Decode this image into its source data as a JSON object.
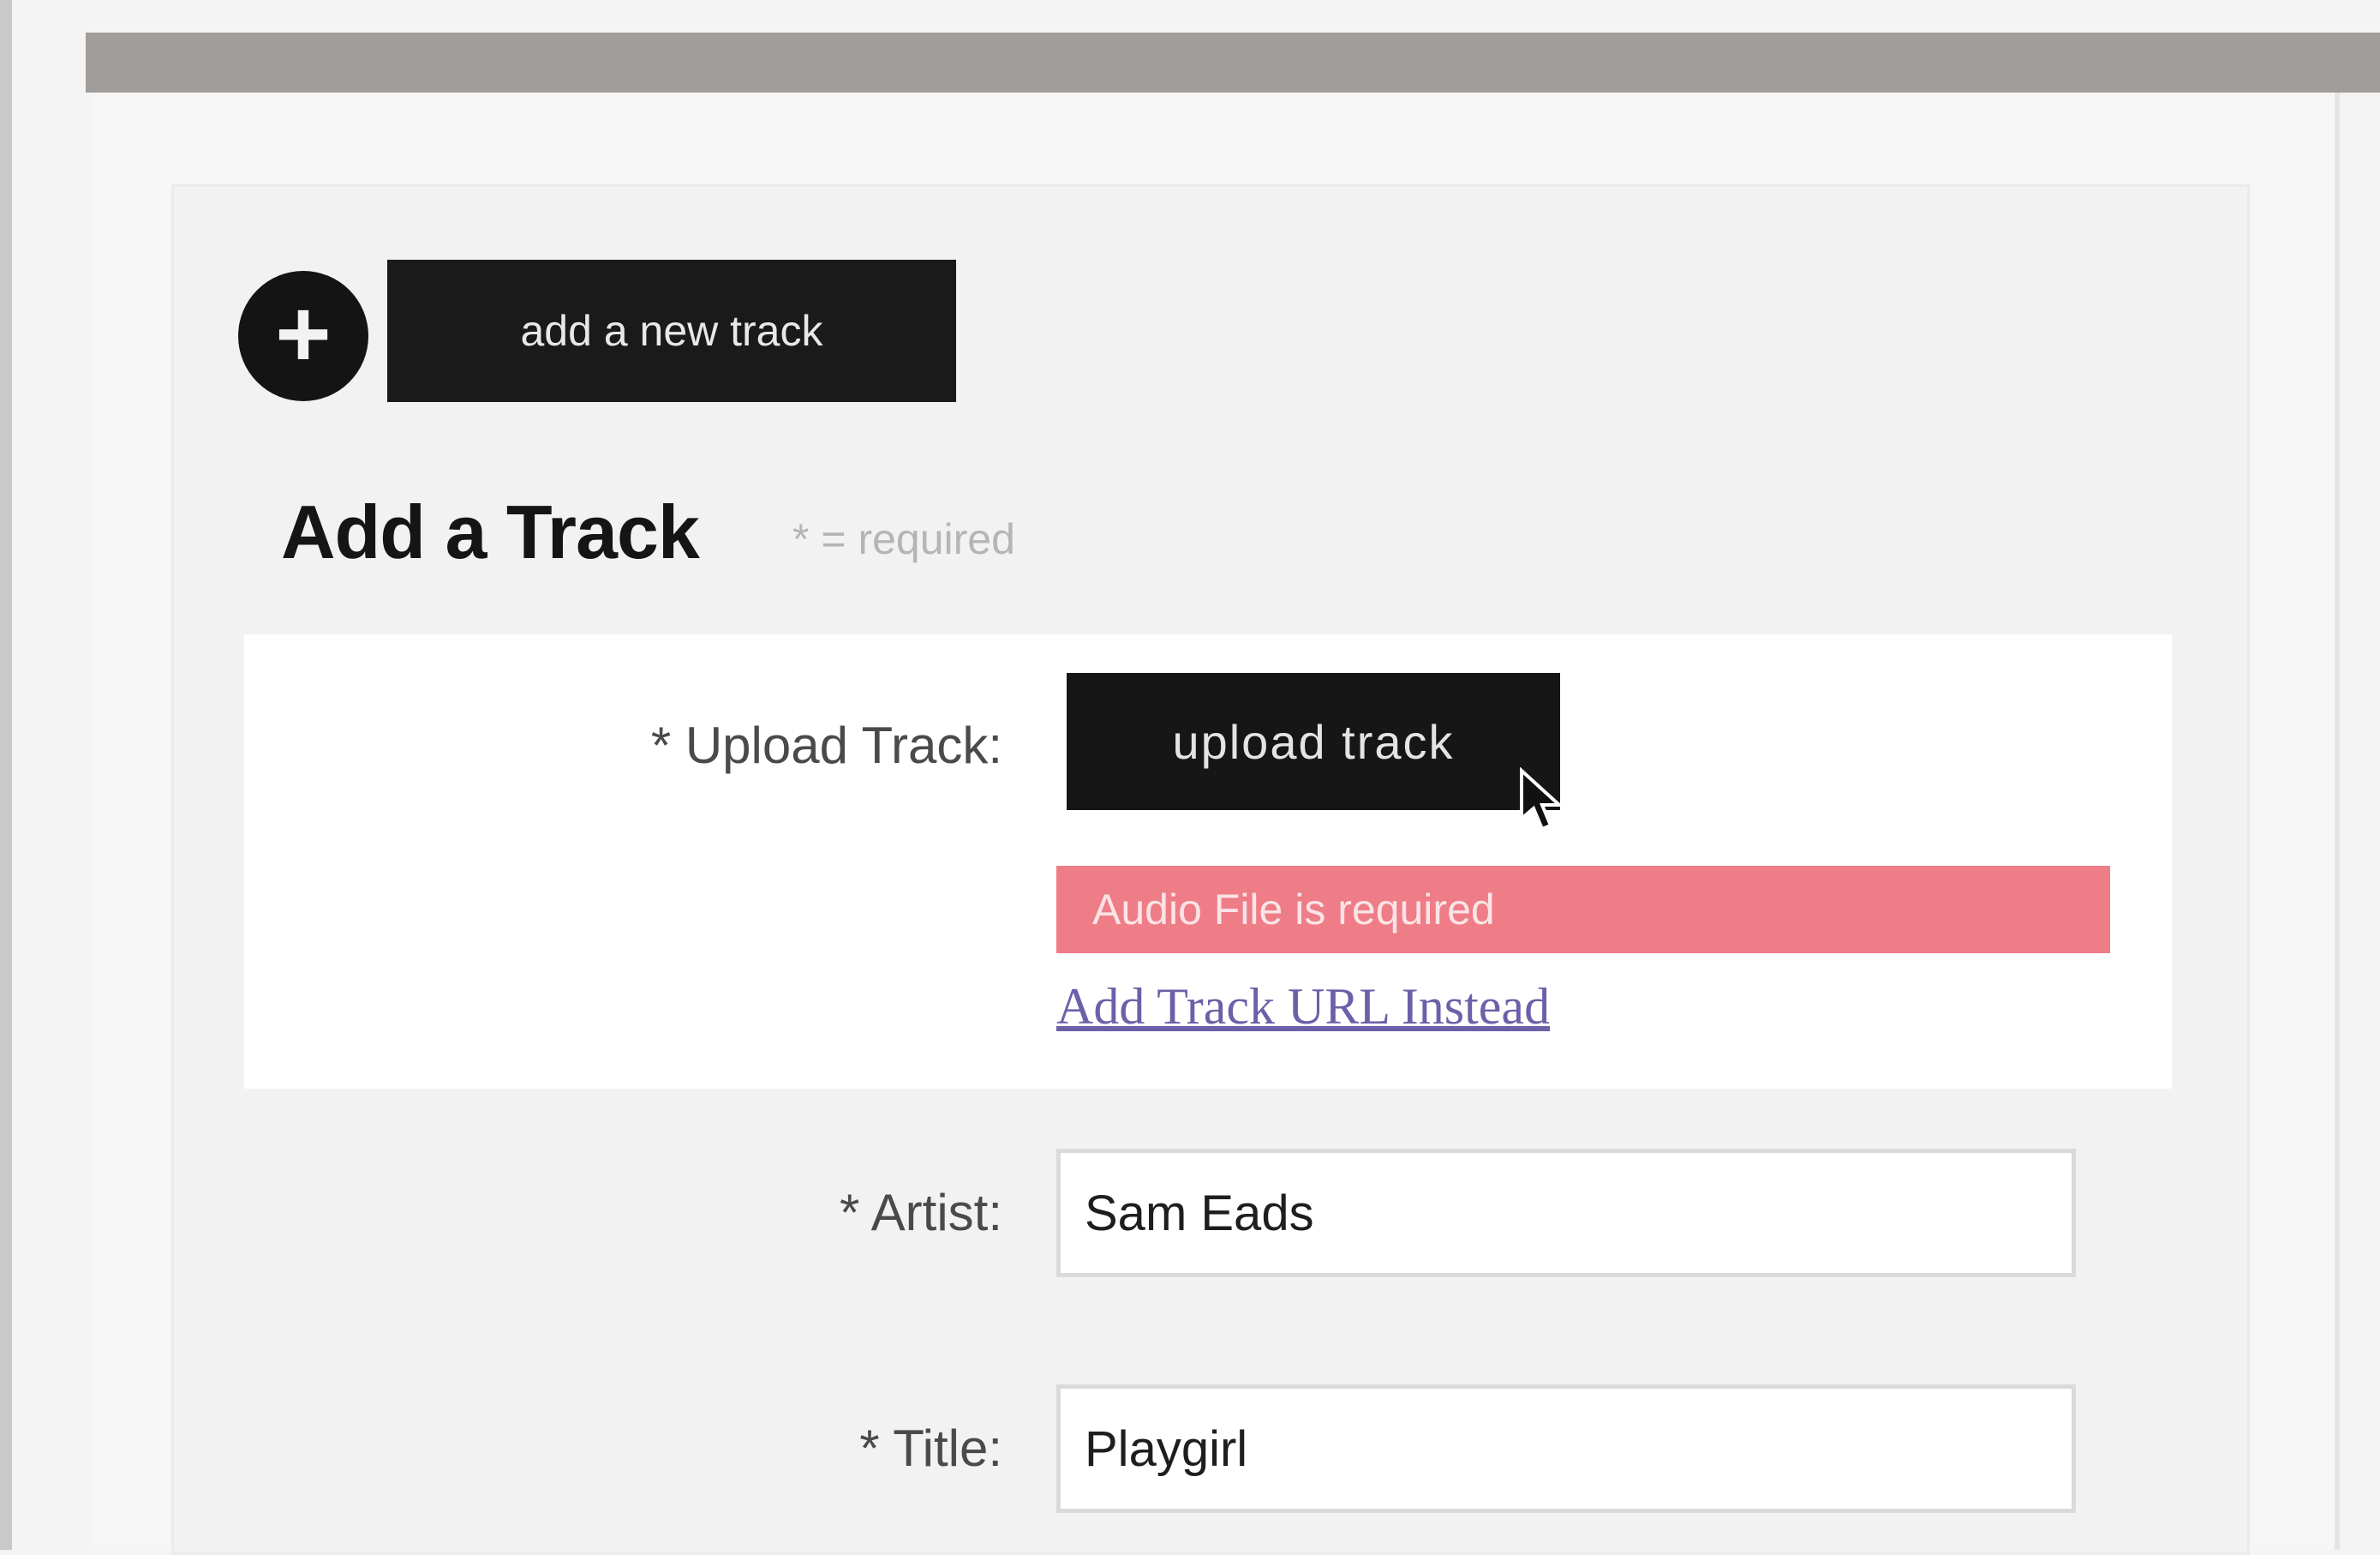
{
  "header": {
    "add_button_symbol": "+",
    "add_new_track_label": "add a new track"
  },
  "form": {
    "title": "Add a Track",
    "required_note": "* = required",
    "upload": {
      "label": "* Upload Track:",
      "button_label": "upload track",
      "error_message": "Audio File is required",
      "url_link": "Add Track URL Instead"
    },
    "artist": {
      "label": "* Artist:",
      "value": "Sam Eads"
    },
    "title_field": {
      "label": "* Title:",
      "value": "Playgirl"
    }
  },
  "colors": {
    "button_bg": "#161616",
    "error_bg": "#ee7d87",
    "link": "#6d5fa8"
  },
  "icons": {
    "add": "plus-icon",
    "cursor": "cursor-icon"
  }
}
